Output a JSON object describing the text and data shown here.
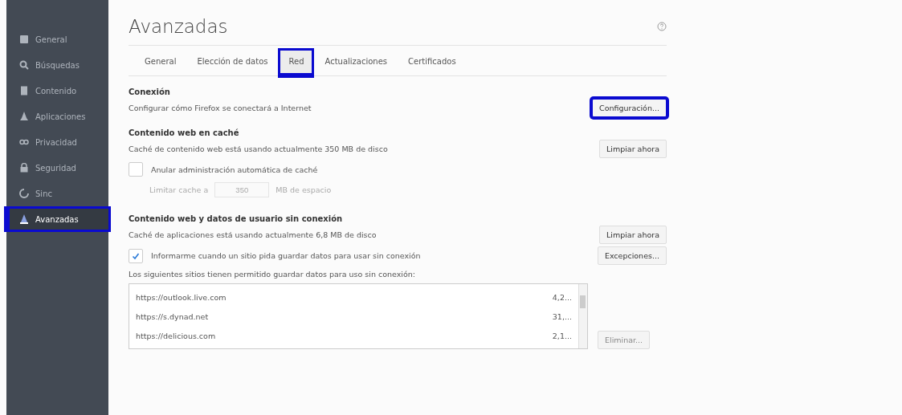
{
  "sidebar": {
    "items": [
      {
        "label": "General",
        "kind": "general",
        "selected": false,
        "highlighted": false
      },
      {
        "label": "Búsquedas",
        "kind": "search",
        "selected": false,
        "highlighted": false
      },
      {
        "label": "Contenido",
        "kind": "content",
        "selected": false,
        "highlighted": false
      },
      {
        "label": "Aplicaciones",
        "kind": "apps",
        "selected": false,
        "highlighted": false
      },
      {
        "label": "Privacidad",
        "kind": "privacy",
        "selected": false,
        "highlighted": false
      },
      {
        "label": "Seguridad",
        "kind": "security",
        "selected": false,
        "highlighted": false
      },
      {
        "label": "Sinc",
        "kind": "sync",
        "selected": false,
        "highlighted": false
      },
      {
        "label": "Avanzadas",
        "kind": "advanced",
        "selected": true,
        "highlighted": true
      }
    ]
  },
  "title": "Avanzadas",
  "tabs": [
    {
      "label": "General",
      "selected": false,
      "highlighted": false
    },
    {
      "label": "Elección de datos",
      "selected": false,
      "highlighted": false
    },
    {
      "label": "Red",
      "selected": true,
      "highlighted": true
    },
    {
      "label": "Actualizaciones",
      "selected": false,
      "highlighted": false
    },
    {
      "label": "Certificados",
      "selected": false,
      "highlighted": false
    }
  ],
  "connection": {
    "heading": "Conexión",
    "text": "Configurar cómo Firefox se conectará a Internet",
    "button": {
      "label": "Configuración...",
      "highlighted": true
    }
  },
  "cache": {
    "heading": "Contenido web en caché",
    "text": "Caché de contenido web está usando actualmente 350 MB de disco",
    "button": {
      "label": "Limpiar ahora",
      "highlighted": false
    },
    "override": {
      "label": "Anular administración automática de caché",
      "checked": false
    },
    "limit": {
      "label": "Limitar cache a",
      "value": "350",
      "unit": "MB de espacio",
      "disabled": true
    }
  },
  "offline": {
    "heading": "Contenido web y datos de usuario sin conexión",
    "text": "Caché de aplicaciones está usando actualmente 6,8 MB de disco",
    "button": {
      "label": "Limpiar ahora",
      "highlighted": false
    },
    "notify": {
      "label": "Informarme cuando un sitio pida guardar datos para usar sin conexión",
      "checked": true
    },
    "exceptions": {
      "label": "Excepciones...",
      "highlighted": false
    },
    "list_caption": "Los siguientes sitios tienen permitido guardar datos para uso sin conexión:",
    "sites": [
      {
        "url": "https://outlook.live.com",
        "size": "4,2..."
      },
      {
        "url": "https://s.dynad.net",
        "size": "31,..."
      },
      {
        "url": "https://delicious.com",
        "size": "2,1..."
      }
    ],
    "remove": {
      "label": "Eliminar...",
      "disabled": true
    }
  }
}
